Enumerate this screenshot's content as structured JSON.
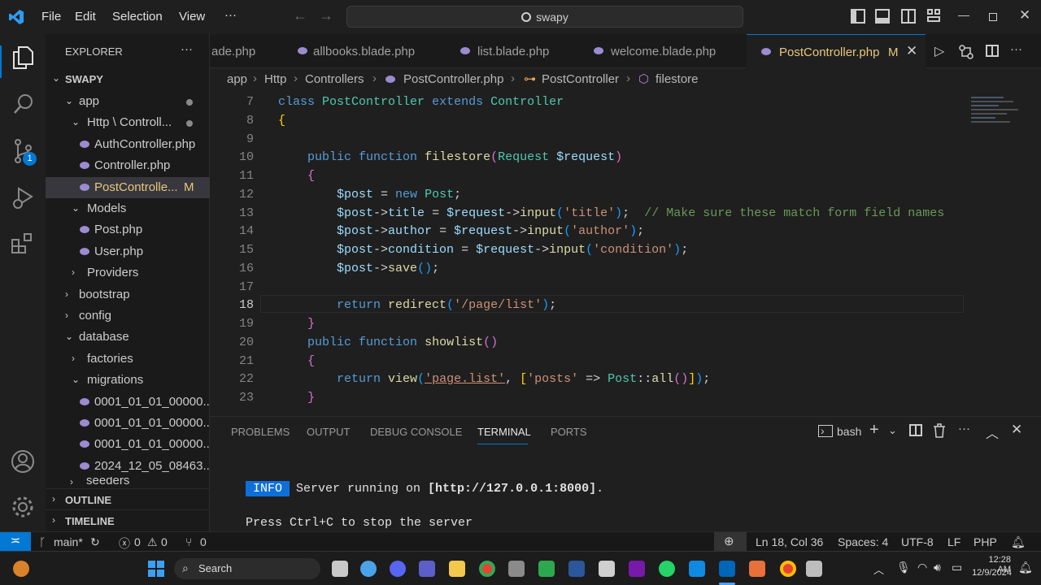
{
  "titlebar": {
    "menu": [
      "File",
      "Edit",
      "Selection",
      "View",
      "···"
    ],
    "search_text": "swapy"
  },
  "activity": {
    "source_control_badge": "1"
  },
  "sidebar": {
    "header": "EXPLORER",
    "more": "···",
    "root": "SWAPY",
    "items": [
      {
        "label": "app",
        "kind": "folder-open",
        "depth": 1
      },
      {
        "label": "Http \\ Controll...",
        "kind": "folder-open",
        "depth": 2
      },
      {
        "label": "AuthController.php",
        "kind": "php",
        "depth": 3
      },
      {
        "label": "Controller.php",
        "kind": "php",
        "depth": 3
      },
      {
        "label": "PostControlle...",
        "kind": "php",
        "depth": 3,
        "badge": "M",
        "selected": true
      },
      {
        "label": "Models",
        "kind": "folder-open",
        "depth": 2
      },
      {
        "label": "Post.php",
        "kind": "php",
        "depth": 3
      },
      {
        "label": "User.php",
        "kind": "php",
        "depth": 3
      },
      {
        "label": "Providers",
        "kind": "folder",
        "depth": 2
      },
      {
        "label": "bootstrap",
        "kind": "folder",
        "depth": 1
      },
      {
        "label": "config",
        "kind": "folder",
        "depth": 1
      },
      {
        "label": "database",
        "kind": "folder-open",
        "depth": 1
      },
      {
        "label": "factories",
        "kind": "folder",
        "depth": 2
      },
      {
        "label": "migrations",
        "kind": "folder-open",
        "depth": 2
      },
      {
        "label": "0001_01_01_00000...",
        "kind": "php",
        "depth": 3
      },
      {
        "label": "0001_01_01_00000...",
        "kind": "php",
        "depth": 3
      },
      {
        "label": "0001_01_01_00000...",
        "kind": "php",
        "depth": 3
      },
      {
        "label": "2024_12_05_08463...",
        "kind": "php",
        "depth": 3
      }
    ],
    "partial": "seeders",
    "outline": "OUTLINE",
    "timeline": "TIMELINE"
  },
  "tabs": [
    {
      "label": "ade.php"
    },
    {
      "label": "allbooks.blade.php"
    },
    {
      "label": "list.blade.php"
    },
    {
      "label": "welcome.blade.php"
    },
    {
      "label": "PostController.php",
      "badge": "M",
      "active": true
    }
  ],
  "breadcrumb": [
    "app",
    "Http",
    "Controllers",
    "PostController.php",
    "PostController",
    "filestore"
  ],
  "editor": {
    "line_numbers": [
      "7",
      "8",
      "9",
      "10",
      "11",
      "12",
      "13",
      "14",
      "15",
      "16",
      "17",
      "18",
      "19",
      "20",
      "21",
      "22",
      "23"
    ],
    "lines": [
      "<span class=\"kw\">class</span> <span class=\"cls\">PostController</span> <span class=\"kw\">extends</span> <span class=\"cls\">Controller</span>",
      "<span class=\"br\">{</span>",
      "",
      "    <span class=\"kw\">public</span> <span class=\"kw\">function</span> <span class=\"fn\">filestore</span><span class=\"br2\">(</span><span class=\"cls\">Request</span> <span class=\"var\">$request</span><span class=\"br2\">)</span>",
      "    <span class=\"br2\">{</span>",
      "        <span class=\"var\">$post</span> = <span class=\"kw\">new</span> <span class=\"cls\">Post</span>;",
      "        <span class=\"var\">$post</span>-><span class=\"var\">title</span> = <span class=\"var\">$request</span>-><span class=\"fn\">input</span><span class=\"br3\">(</span><span class=\"str\">'title'</span><span class=\"br3\">)</span>;  <span class=\"cmt\">// Make sure these match form field names</span>",
      "        <span class=\"var\">$post</span>-><span class=\"var\">author</span> = <span class=\"var\">$request</span>-><span class=\"fn\">input</span><span class=\"br3\">(</span><span class=\"str\">'author'</span><span class=\"br3\">)</span>;",
      "        <span class=\"var\">$post</span>-><span class=\"var\">condition</span> = <span class=\"var\">$request</span>-><span class=\"fn\">input</span><span class=\"br3\">(</span><span class=\"str\">'condition'</span><span class=\"br3\">)</span>;",
      "        <span class=\"var\">$post</span>-><span class=\"fn\">save</span><span class=\"br3\">()</span>;",
      "",
      "        <span class=\"kw\">return</span> <span class=\"fn\">redirect</span><span class=\"br3\">(</span><span class=\"str\">'/page/list'</span><span class=\"br3\">)</span>;",
      "    <span class=\"br2\">}</span>",
      "    <span class=\"kw\">public</span> <span class=\"kw\">function</span> <span class=\"fn\">showlist</span><span class=\"br2\">()</span>",
      "    <span class=\"br2\">{</span>",
      "        <span class=\"kw\">return</span> <span class=\"fn\">view</span><span class=\"br3\">(</span><span class=\"str\" style=\"text-decoration:underline\">'page.list'</span>, <span class=\"br\">[</span><span class=\"str\">'posts'</span> => <span class=\"cls\">Post</span>::<span class=\"fn\">all</span><span class=\"br2\">()</span><span class=\"br\">]</span><span class=\"br3\">)</span>;",
      "    <span class=\"br2\">}</span>"
    ]
  },
  "panel": {
    "tabs": [
      "PROBLEMS",
      "OUTPUT",
      "DEBUG CONSOLE",
      "TERMINAL",
      "PORTS"
    ],
    "active_tab": "TERMINAL",
    "shell": "bash",
    "terminal": {
      "info_badge": "INFO",
      "server_line_pre": "Server running on ",
      "server_url": "[http://127.0.0.1:8000]",
      "server_line_post": ".",
      "stop_line": "Press Ctrl+C to stop the server"
    }
  },
  "statusbar": {
    "branch": "main*",
    "errors": "0",
    "warnings": "0",
    "ports": "0",
    "position": "Ln 18, Col 36",
    "spaces": "Spaces: 4",
    "encoding": "UTF-8",
    "eol": "LF",
    "language": "PHP"
  },
  "taskbar": {
    "search": "Search",
    "time": "12:28 AM",
    "date": "12/9/2024"
  },
  "colors": {
    "accent": "#0078d4",
    "php_icon": "#9b8bd1",
    "info_badge": "#0e6fd8"
  }
}
